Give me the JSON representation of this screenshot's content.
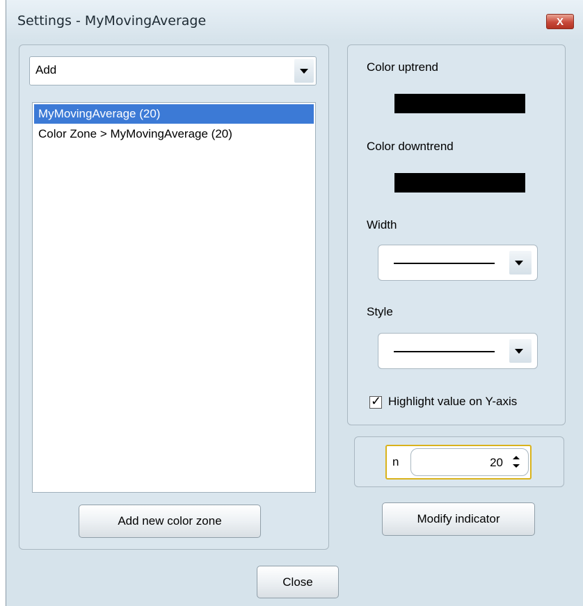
{
  "window": {
    "title": "Settings - MyMovingAverage",
    "close_icon_label": "X"
  },
  "left": {
    "add_combo": {
      "value": "Add"
    },
    "list_items": [
      {
        "label": "MyMovingAverage (20)",
        "selected": true
      },
      {
        "label": "Color Zone > MyMovingAverage (20)",
        "selected": false
      }
    ],
    "add_zone_button": "Add new color zone"
  },
  "right": {
    "color_uptrend_label": "Color uptrend",
    "color_uptrend_value": "#000000",
    "color_downtrend_label": "Color downtrend",
    "color_downtrend_value": "#000000",
    "width_label": "Width",
    "style_label": "Style",
    "highlight_label": "Highlight value on Y-axis",
    "highlight_checked": true
  },
  "params": {
    "n_label": "n",
    "n_value": "20"
  },
  "modify_button": "Modify indicator",
  "close_button": "Close",
  "colors": {
    "window_bg": "#d6e3eb",
    "selection": "#3c7ad6",
    "focus_border": "#d9b21b",
    "close_red": "#c8493a"
  }
}
